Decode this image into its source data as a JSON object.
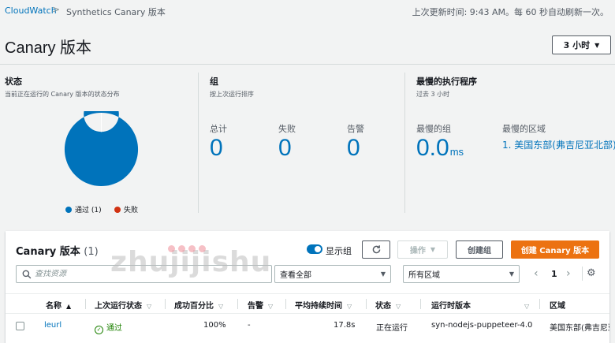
{
  "breadcrumb": {
    "root": "CloudWatch",
    "separator": ">",
    "current": "Synthetics Canary 版本"
  },
  "update_note": "上次更新时间: 9:43 AM。每 60 秒自动刷新一次。",
  "page_title": "Canary 版本",
  "time_range": {
    "value": "3 小时"
  },
  "status_panel": {
    "title": "状态",
    "subtitle": "当前正在运行的 Canary 版本的状态分布",
    "legend": [
      {
        "label": "通过 (1)",
        "color": "#0073bb"
      },
      {
        "label": "失败",
        "color": "#d13212"
      }
    ]
  },
  "chart_data": {
    "type": "pie",
    "donut": true,
    "categories": [
      "通过 (1)",
      "失败"
    ],
    "values": [
      1,
      0
    ],
    "colors": [
      "#0073bb",
      "#d13212"
    ]
  },
  "groups_panel": {
    "title": "组",
    "subtitle": "按上次运行排序",
    "metrics": [
      {
        "label": "总计",
        "value": "0"
      },
      {
        "label": "失败",
        "value": "0"
      },
      {
        "label": "告警",
        "value": "0"
      }
    ]
  },
  "slowest_panel": {
    "title": "最慢的执行程序",
    "subtitle": "过去 3 小时",
    "slowest_group_label": "最慢的组",
    "slowest_group_value": "0.0",
    "slowest_group_unit": "ms",
    "slowest_region_label": "最慢的区域",
    "slowest_region_value": "1. 美国东部(弗吉尼亚北部)"
  },
  "table": {
    "title": "Canary 版本",
    "count": "(1)",
    "show_groups_label": "显示组",
    "show_groups_on": true,
    "refresh_icon": "refresh-icon",
    "actions_label": "操作",
    "create_group_label": "创建组",
    "create_canary_label": "创建 Canary 版本",
    "search_placeholder": "查找资源",
    "filter_view": "查看全部",
    "filter_region": "所有区域",
    "page": "1",
    "columns": [
      "名称",
      "上次运行状态",
      "成功百分比",
      "告警",
      "平均持续时间",
      "状态",
      "运行时版本",
      "区域"
    ],
    "rows": [
      {
        "name": "leurl",
        "last_run": "通过",
        "success": "100%",
        "alarms": "-",
        "avg_duration": "17.8s",
        "state": "正在运行",
        "runtime": "syn-nodejs-puppeteer-4.0",
        "region": "美国东部(弗吉尼亚北部)"
      }
    ]
  },
  "watermark": "zhujijishu",
  "colors": {
    "accent": "#0073bb",
    "primary_button": "#ec7211",
    "success": "#1d8102",
    "error": "#d13212"
  }
}
